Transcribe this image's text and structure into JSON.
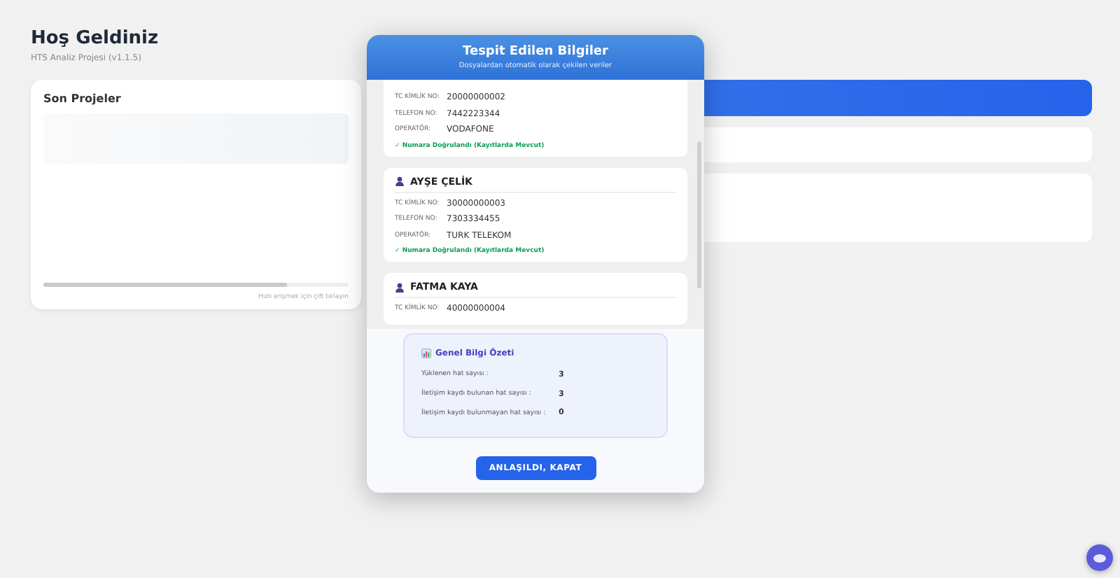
{
  "header": {
    "title": "Hoş Geldiniz",
    "subtitle": "HTS Analiz Projesi (v1.1.5)"
  },
  "recent_projects": {
    "title": "Son Projeler",
    "hint": "Hızlı erişmek için çift tıklayın"
  },
  "modal": {
    "title": "Tespit Edilen Bilgiler",
    "subtitle": "Dosyalardan otomatik olarak çekilen veriler",
    "persons": [
      {
        "fields": [
          {
            "label": "TC KİMLİK NO:",
            "value": "20000000002"
          },
          {
            "label": "TELEFON NO:",
            "value": "7442223344"
          },
          {
            "label": "OPERATÖR:",
            "value": "VODAFONE"
          }
        ],
        "verified": "✓ Numara Doğrulandı (Kayıtlarda Mevcut)"
      },
      {
        "name": "AYŞE ÇELİK",
        "fields": [
          {
            "label": "TC KİMLİK NO:",
            "value": "30000000003"
          },
          {
            "label": "TELEFON NO:",
            "value": "7303334455"
          },
          {
            "label": "OPERATÖR:",
            "value": "TURK TELEKOM"
          }
        ],
        "verified": "✓ Numara Doğrulandı (Kayıtlarda Mevcut)"
      },
      {
        "name": "FATMA KAYA",
        "fields": [
          {
            "label": "TC KİMLİK NO:",
            "value": "40000000004"
          }
        ]
      }
    ],
    "summary": {
      "title": "Genel Bilgi Özeti",
      "rows": [
        {
          "label": "Yüklenen hat sayısı :",
          "value": "3"
        },
        {
          "label": "İletişim kaydı bulunan hat sayısı :",
          "value": "3"
        },
        {
          "label": "İletişim kaydı bulunmayan hat sayısı :",
          "value": "0"
        }
      ]
    },
    "button": "ANLAŞILDI, KAPAT"
  }
}
